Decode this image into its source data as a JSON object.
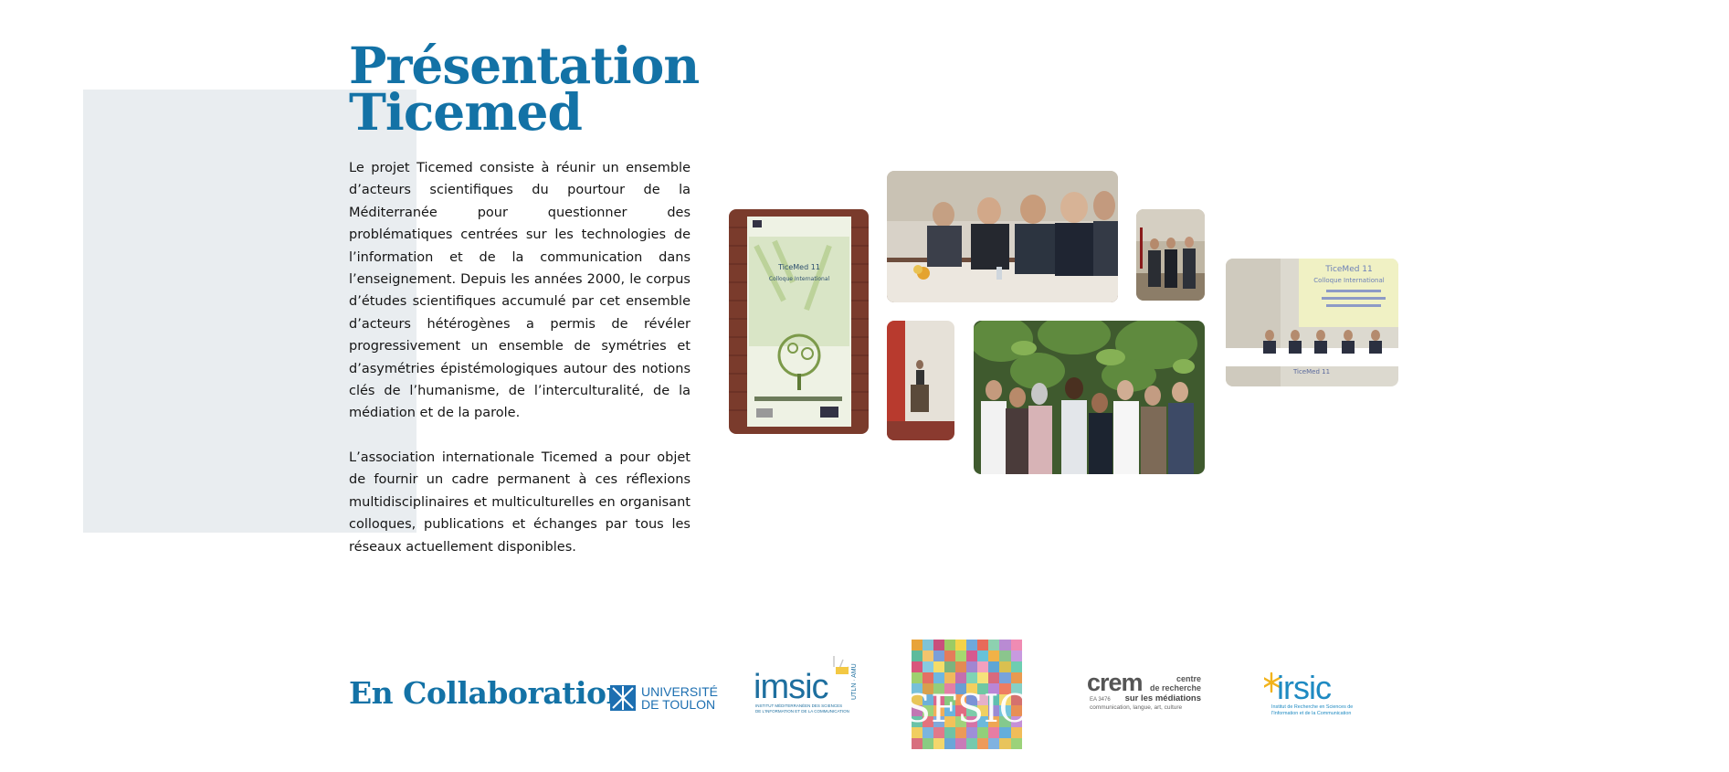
{
  "heading": {
    "line1": "Présentation",
    "line2": "Ticemed"
  },
  "paragraphs": [
    "Le projet Ticemed consiste à réunir un ensemble d’acteurs scientifiques du pourtour de la Méditerranée pour questionner des problématiques centrées sur les technologies de l’information et de la communication dans l’enseignement. Depuis les années 2000, le corpus d’études scientifiques accumulé par cet ensemble d’acteurs hétérogènes a permis de révéler progressivement un ensemble de symétries et d’asymétries épistémologiques autour des notions clés de l’humanisme, de l’interculturalité, de la médiation et de la parole.",
    "L’association internationale Ticemed a pour objet de fournir un cadre permanent à ces réflexions multidisciplinaires et multiculturelles en organisant colloques, publications et échanges par tous les réseaux actuellement disponibles."
  ],
  "photos": {
    "banner": {
      "title": "TiceMed 11",
      "subtitle": "Colloque International"
    },
    "screen": {
      "title": "TiceMed 11",
      "subtitle": "Colloque International",
      "caption": "TiceMed 11"
    }
  },
  "collaboration": {
    "title": "En Collaboration",
    "logos": {
      "toulon": {
        "line1": "UNIVERSITÉ",
        "line2": "DE TOULON"
      },
      "imsic": {
        "name": "imsic",
        "tag": "UTLN · AMU",
        "sub1": "INSTITUT MÉDITERRANÉEN DES SCIENCES",
        "sub2": "DE L'INFORMATION ET DE LA COMMUNICATION"
      },
      "sfsic": {
        "name": "SFSIC"
      },
      "crem": {
        "name": "crem",
        "right1": "centre",
        "right2": "de recherche",
        "right3": "sur les médiations",
        "code": "EA 3476",
        "sub": "communication, langue, art, culture"
      },
      "irsic": {
        "name": "irsic",
        "sub1": "Institut de Recherche en Sciences de",
        "sub2": "l'Information et de la Communication"
      }
    }
  },
  "colors": {
    "accent": "#1372a6",
    "bg_block": "#e9edf0",
    "irsic_star": "#f2b31b"
  }
}
